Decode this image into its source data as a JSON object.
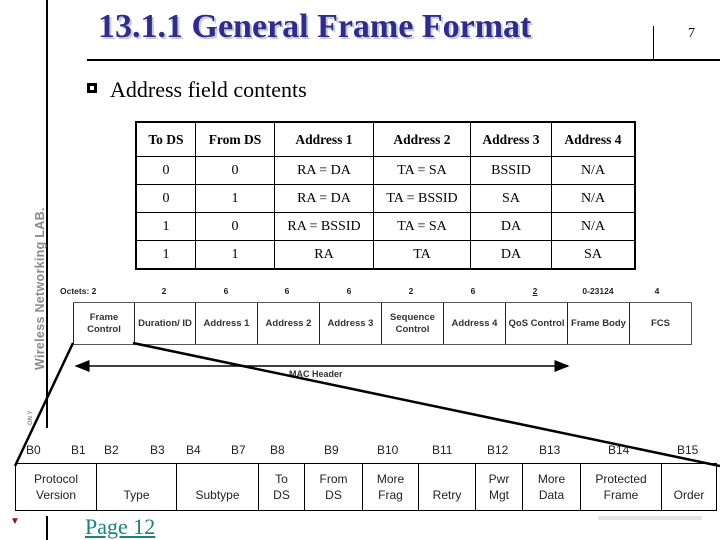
{
  "header": {
    "title": "13.1.1 General Frame Format",
    "slide_number": "7"
  },
  "sidebar": {
    "vertical_text": "Wireless Networking LAB.",
    "small_text": "ON Y"
  },
  "bullet": {
    "text": "Address field contents"
  },
  "address_table": {
    "columns": [
      "To DS",
      "From DS",
      "Address 1",
      "Address 2",
      "Address 3",
      "Address 4"
    ],
    "rows": [
      [
        "0",
        "0",
        "RA = DA",
        "TA = SA",
        "BSSID",
        "N/A"
      ],
      [
        "0",
        "1",
        "RA = DA",
        "TA = BSSID",
        "SA",
        "N/A"
      ],
      [
        "1",
        "0",
        "RA = BSSID",
        "TA = SA",
        "DA",
        "N/A"
      ],
      [
        "1",
        "1",
        "RA",
        "TA",
        "DA",
        "SA"
      ]
    ]
  },
  "frame_format": {
    "octets_label": "Octets: 2",
    "octets": [
      "2",
      "6",
      "6",
      "6",
      "2",
      "6",
      "2",
      "0-23124",
      "4"
    ],
    "fields": [
      "Frame Control",
      "Duration/ ID",
      "Address 1",
      "Address 2",
      "Address 3",
      "Sequence Control",
      "Address 4",
      "QoS Control",
      "Frame Body",
      "FCS"
    ],
    "mac_header_label": "MAC Header"
  },
  "frame_control": {
    "bit_labels": [
      "B0",
      "B1",
      "B2",
      "B3",
      "B4",
      "B7",
      "B8",
      "B9",
      "B10",
      "B11",
      "B12",
      "B13",
      "B14",
      "B15"
    ],
    "fields": [
      [
        "Protocol",
        "Version"
      ],
      [
        "",
        "Type"
      ],
      [
        "",
        "Subtype"
      ],
      [
        "To",
        "DS"
      ],
      [
        "From",
        "DS"
      ],
      [
        "More",
        "Frag"
      ],
      [
        "",
        "Retry"
      ],
      [
        "Pwr",
        "Mgt"
      ],
      [
        "More",
        "Data"
      ],
      [
        "Protected",
        "Frame"
      ],
      [
        "",
        "Order"
      ]
    ]
  },
  "footer": {
    "page_link": "Page 12"
  },
  "colors": {
    "title": "#2e2e8a",
    "link": "#1a8080",
    "sidebar_text": "#8a8a8a"
  }
}
